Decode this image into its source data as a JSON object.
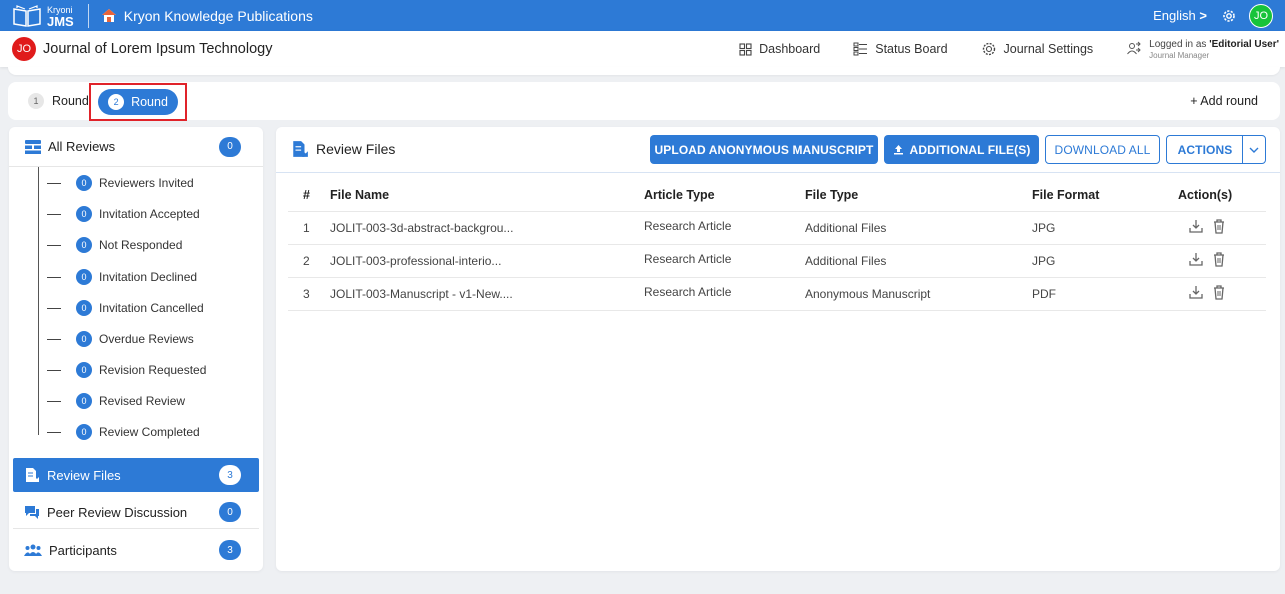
{
  "topbar": {
    "logo_small": "Kryoni",
    "logo_big": "JMS",
    "publisher": "Kryon Knowledge Publications",
    "language": "English",
    "language_caret": ">",
    "user_initials": "JO"
  },
  "subheader": {
    "journal_initials": "JO",
    "journal_title": "Journal of Lorem Ipsum Technology",
    "nav": [
      "Dashboard",
      "Status Board",
      "Journal Settings"
    ],
    "logged_in_prefix": "Logged in as ",
    "logged_in_user": "'Editorial User'",
    "role": "Journal Manager"
  },
  "rounds": {
    "round1_num": "1",
    "round1_label": "Round",
    "round2_num": "2",
    "round2_label": "Round",
    "add_label": "+ Add round"
  },
  "sidebar": {
    "all_reviews": {
      "label": "All Reviews",
      "count": "0"
    },
    "subitems": [
      {
        "label": "Reviewers Invited",
        "count": "0"
      },
      {
        "label": "Invitation Accepted",
        "count": "0"
      },
      {
        "label": "Not Responded",
        "count": "0"
      },
      {
        "label": "Invitation Declined",
        "count": "0"
      },
      {
        "label": "Invitation Cancelled",
        "count": "0"
      },
      {
        "label": "Overdue Reviews",
        "count": "0"
      },
      {
        "label": "Revision Requested",
        "count": "0"
      },
      {
        "label": "Revised Review",
        "count": "0"
      },
      {
        "label": "Review Completed",
        "count": "0"
      }
    ],
    "review_files": {
      "label": "Review Files",
      "count": "3"
    },
    "peer_review": {
      "label": "Peer Review Discussion",
      "count": "0"
    },
    "participants": {
      "label": "Participants",
      "count": "3"
    }
  },
  "main": {
    "title": "Review Files",
    "btn_upload": "UPLOAD ANONYMOUS MANUSCRIPT",
    "btn_additional": "ADDITIONAL FILE(S)",
    "btn_download": "DOWNLOAD ALL",
    "btn_actions": "ACTIONS",
    "columns": [
      "#",
      "File Name",
      "Article Type",
      "File Type",
      "File Format",
      "Action(s)"
    ],
    "rows": [
      {
        "num": "1",
        "name": "JOLIT-003-3d-abstract-backgrou...",
        "article": "Research Article",
        "filetype": "Additional Files",
        "format": "JPG"
      },
      {
        "num": "2",
        "name": "JOLIT-003-professional-interio...",
        "article": "Research Article",
        "filetype": "Additional Files",
        "format": "JPG"
      },
      {
        "num": "3",
        "name": "JOLIT-003-Manuscript - v1-New....",
        "article": "Research Article",
        "filetype": "Anonymous Manuscript",
        "format": "PDF"
      }
    ]
  },
  "colors": {
    "primary": "#2d7ad6",
    "highlight": "#e0232a",
    "avatar_green": "#17c33a",
    "journal_red": "#e01b1b"
  }
}
